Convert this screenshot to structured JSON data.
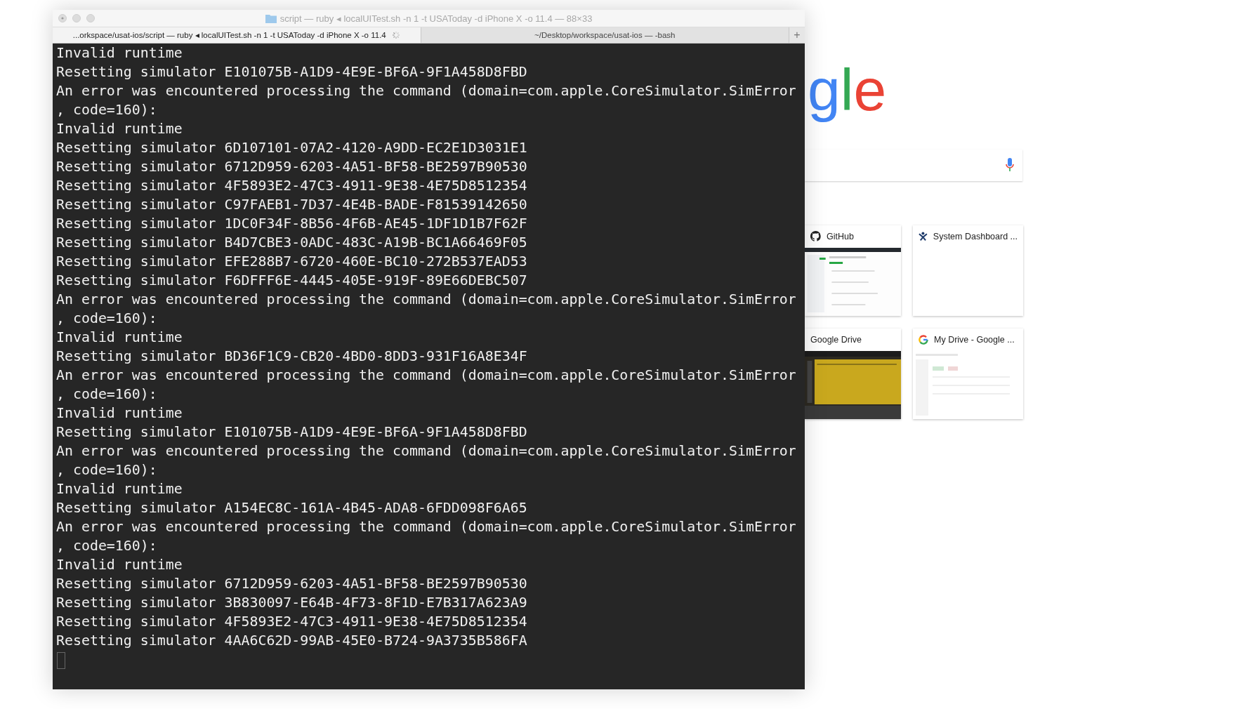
{
  "terminal": {
    "title": "script — ruby ◂ localUITest.sh -n 1 -t USAToday -d iPhone X -o 11.4 — 88×33",
    "tabs": [
      {
        "label": "...orkspace/usat-ios/script — ruby ◂ localUITest.sh -n 1 -t USAToday -d iPhone X -o 11.4",
        "selected": true,
        "busy": true
      },
      {
        "label": "~/Desktop/workspace/usat-ios — -bash",
        "selected": false,
        "busy": false
      }
    ],
    "new_tab": "+",
    "lines": [
      "Invalid runtime",
      "Resetting simulator E101075B-A1D9-4E9E-BF6A-9F1A458D8FBD",
      "An error was encountered processing the command (domain=com.apple.CoreSimulator.SimError",
      ", code=160):",
      "Invalid runtime",
      "Resetting simulator 6D107101-07A2-4120-A9DD-EC2E1D3031E1",
      "Resetting simulator 6712D959-6203-4A51-BF58-BE2597B90530",
      "Resetting simulator 4F5893E2-47C3-4911-9E38-4E75D8512354",
      "Resetting simulator C97FAEB1-7D37-4E4B-BADE-F81539142650",
      "Resetting simulator 1DC0F34F-8B56-4F6B-AE45-1DF1D1B7F62F",
      "Resetting simulator B4D7CBE3-0ADC-483C-A19B-BC1A66469F05",
      "Resetting simulator EFE288B7-6720-460E-BC10-272B537EAD53",
      "Resetting simulator F6DFFF6E-4445-405E-919F-89E66DEBC507",
      "An error was encountered processing the command (domain=com.apple.CoreSimulator.SimError",
      ", code=160):",
      "Invalid runtime",
      "Resetting simulator BD36F1C9-CB20-4BD0-8DD3-931F16A8E34F",
      "An error was encountered processing the command (domain=com.apple.CoreSimulator.SimError",
      ", code=160):",
      "Invalid runtime",
      "Resetting simulator E101075B-A1D9-4E9E-BF6A-9F1A458D8FBD",
      "An error was encountered processing the command (domain=com.apple.CoreSimulator.SimError",
      ", code=160):",
      "Invalid runtime",
      "Resetting simulator A154EC8C-161A-4B45-ADA8-6FDD098F6A65",
      "An error was encountered processing the command (domain=com.apple.CoreSimulator.SimError",
      ", code=160):",
      "Invalid runtime",
      "Resetting simulator 6712D959-6203-4A51-BF58-BE2597B90530",
      "Resetting simulator 3B830097-E64B-4F73-8F1D-E7B317A623A9",
      "Resetting simulator 4F5893E2-47C3-4911-9E38-4E75D8512354",
      "Resetting simulator 4AA6C62D-99AB-45E0-B724-9A3735B586FA"
    ]
  },
  "browser": {
    "logo": [
      {
        "text": "g",
        "color": "#4285f4"
      },
      {
        "text": "l",
        "color": "#34a853"
      },
      {
        "text": "e",
        "color": "#ea4335"
      }
    ],
    "tiles": [
      [
        {
          "title": "GitHub",
          "favicon": {
            "kind": "github"
          },
          "thumbnail": {
            "kind": "dark"
          }
        },
        {
          "title": "System Dashboard ...",
          "favicon": {
            "kind": "dashboard"
          }
        }
      ],
      [
        {
          "title": "Google Drive",
          "thumbnail": {
            "kind": "yellow"
          }
        },
        {
          "title": "My Drive - Google ...",
          "favicon": {
            "kind": "google"
          },
          "thumbnail": {
            "kind": "light"
          }
        }
      ]
    ]
  }
}
